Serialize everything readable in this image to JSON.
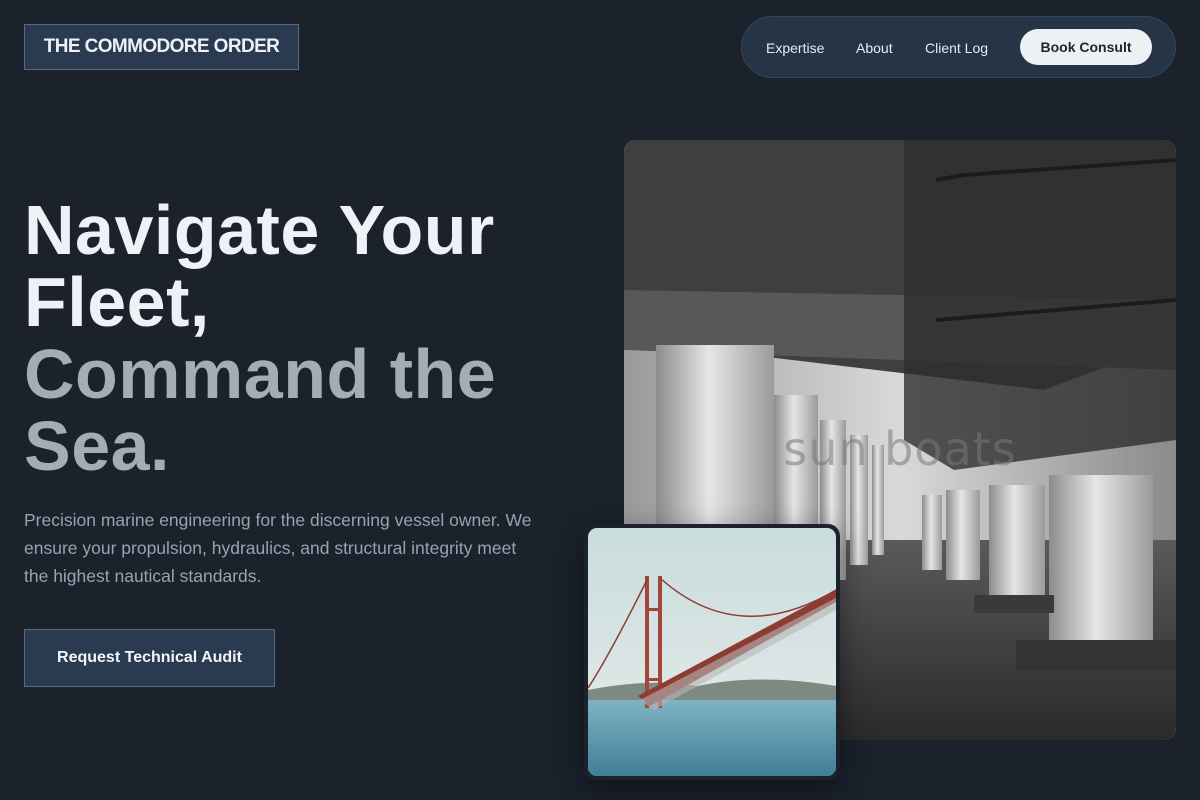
{
  "brand": {
    "name": "THE COMMODORE ORDER"
  },
  "nav": {
    "links": [
      "Expertise",
      "About",
      "Client Log"
    ],
    "cta_label": "Book Consult"
  },
  "hero": {
    "headline_line1": "Navigate Your",
    "headline_line2": "Fleet,",
    "headline_line3": "Command the",
    "headline_line4": "Sea.",
    "description": "Precision marine engineering for the discerning vessel owner. We ensure your propulsion, hydraulics, and structural integrity meet the highest nautical standards.",
    "cta_label": "Request Technical Audit"
  },
  "images": {
    "main_overlay_text": "sun boats",
    "main_subject": "black-and-white photo of concrete bridge pillars over water",
    "inset_subject": "red suspension bridge over blue sea"
  },
  "colors": {
    "background": "#1b222c",
    "panel": "#2a3a50",
    "nav_pill": "#263446",
    "muted_text": "#97a3b0",
    "headline_muted": "#a4acb5"
  }
}
